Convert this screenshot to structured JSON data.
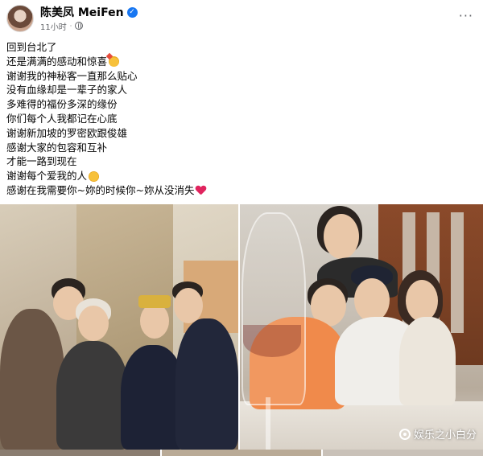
{
  "post": {
    "author": "陈美凤 MeiFen",
    "time": "11小时",
    "more_label": "···",
    "verified_mark": "✓",
    "lines": [
      "回到台北了",
      "还是满满的感动和惊喜",
      "谢谢我的神秘客一直那么贴心",
      "没有血缘却是一辈子的家人",
      "多难得的福份多深的缘份",
      "你们每个人我都记在心底",
      "谢谢新加坡的罗密欧跟俊雄",
      "感谢大家的包容和互补",
      "才能一路到现在",
      "谢谢每个爱我的人",
      "感谢在我需要你~妳的时候你~妳从没消失"
    ],
    "emoji_icons": [
      "party-face-icon",
      "kissing-face-icon",
      "red-heart-icon"
    ]
  },
  "watermark": {
    "text": "娱乐之小白分"
  }
}
